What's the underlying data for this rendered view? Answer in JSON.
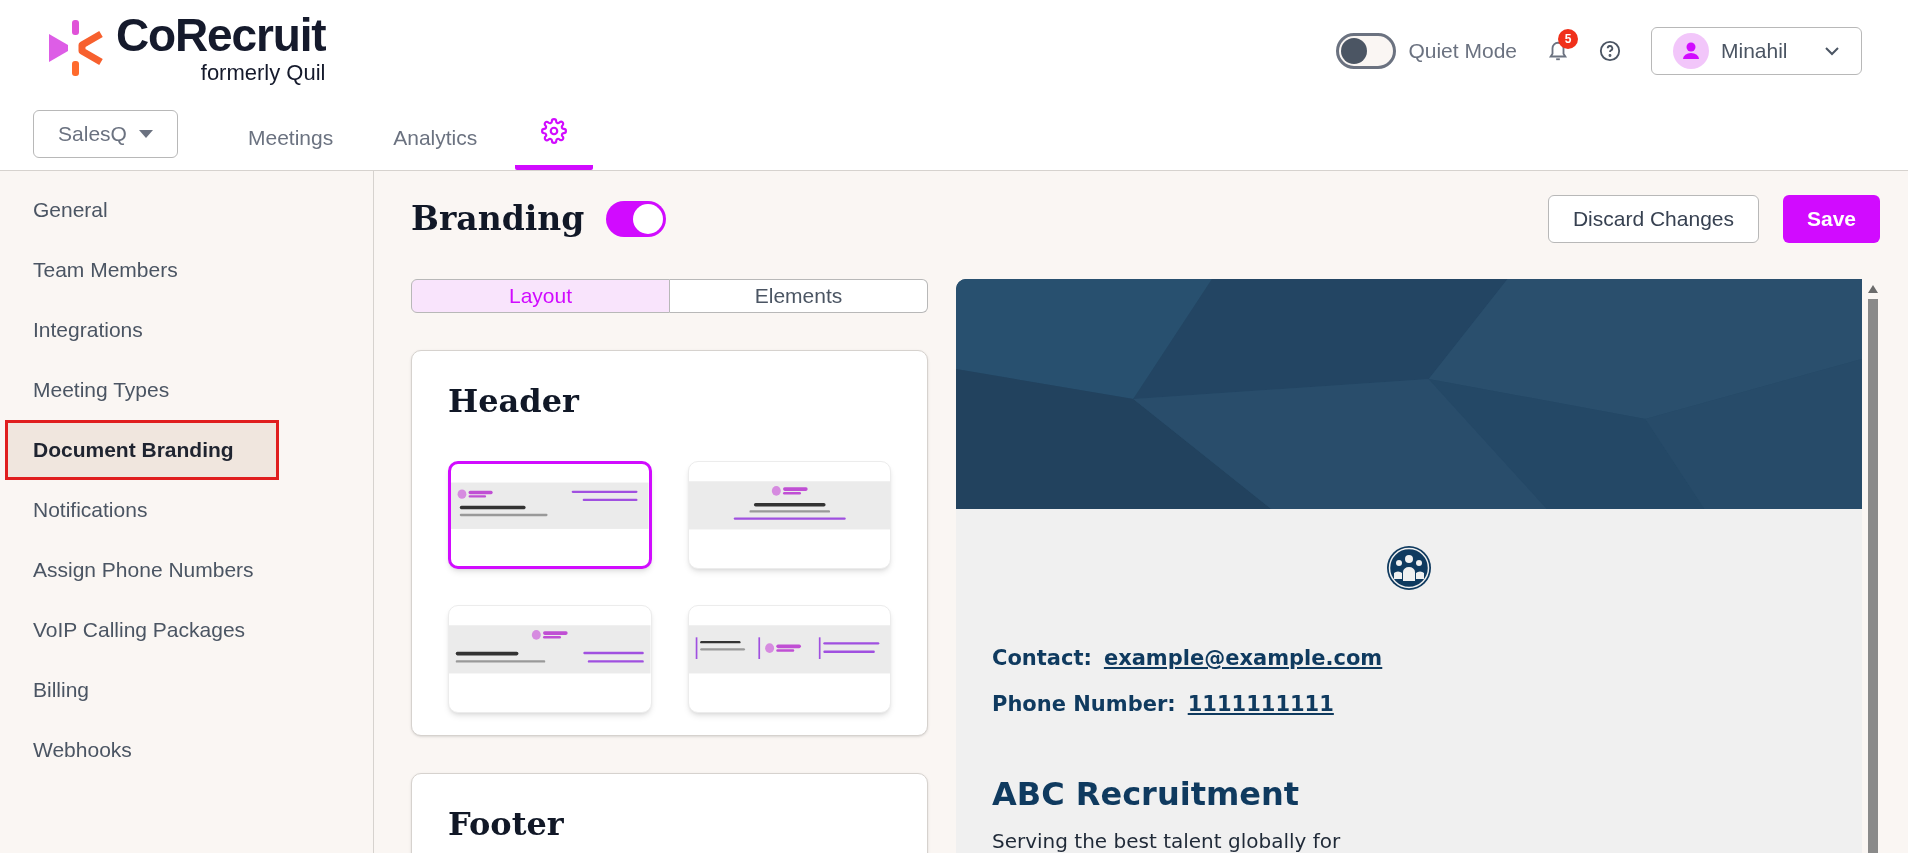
{
  "logo": {
    "name": "CoRecruit",
    "tagline": "formerly Quil"
  },
  "topbar": {
    "quiet_mode": {
      "label": "Quiet Mode",
      "on": false
    },
    "notifications": {
      "count": "5"
    },
    "user": {
      "name": "Minahil"
    }
  },
  "nav": {
    "workspace": "SalesQ",
    "tabs": [
      {
        "kind": "text",
        "label": "Meetings",
        "selected": false
      },
      {
        "kind": "text",
        "label": "Analytics",
        "selected": false
      },
      {
        "kind": "settings",
        "selected": true
      }
    ]
  },
  "sidebar": {
    "items": [
      {
        "label": "General",
        "selected": false
      },
      {
        "label": "Team Members",
        "selected": false
      },
      {
        "label": "Integrations",
        "selected": false
      },
      {
        "label": "Meeting Types",
        "selected": false
      },
      {
        "label": "Document Branding",
        "selected": true
      },
      {
        "label": "Notifications",
        "selected": false
      },
      {
        "label": "Assign Phone Numbers",
        "selected": false
      },
      {
        "label": "VoIP Calling Packages",
        "selected": false
      },
      {
        "label": "Billing",
        "selected": false
      },
      {
        "label": "Webhooks",
        "selected": false
      }
    ]
  },
  "page": {
    "title": "Branding",
    "enabled": true,
    "discard": "Discard Changes",
    "save": "Save"
  },
  "tabs": [
    {
      "label": "Layout",
      "selected": true
    },
    {
      "label": "Elements",
      "selected": false
    }
  ],
  "sections": [
    {
      "title": "Header",
      "layouts": [
        {
          "kind": "left",
          "selected": true
        },
        {
          "kind": "centered",
          "selected": false
        },
        {
          "kind": "split",
          "selected": false
        },
        {
          "kind": "columns",
          "selected": false
        }
      ]
    },
    {
      "title": "Footer"
    }
  ],
  "preview": {
    "contact_label": "Contact:",
    "contact": "example@example.com",
    "phone_label": "Phone Number:",
    "phone": "1111111111",
    "company": "ABC Recruitment",
    "description": "Serving the best talent globally for"
  }
}
